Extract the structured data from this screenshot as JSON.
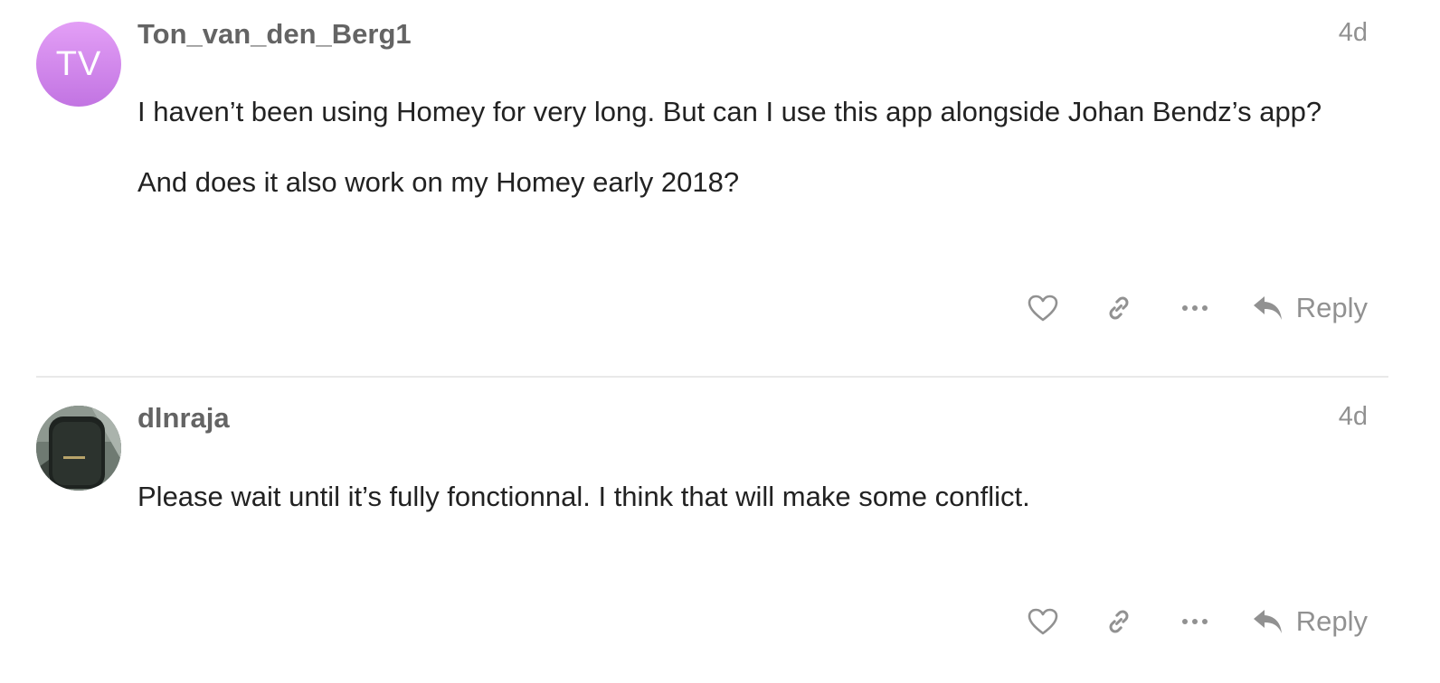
{
  "colors": {
    "avatar_tv_gradient_top": "#e39ff6",
    "avatar_tv_gradient_bottom": "#c274e2",
    "username": "#646464",
    "date": "#919191",
    "body_text": "#222222",
    "icon": "#919191",
    "divider": "#e9e9e9"
  },
  "posts": [
    {
      "username": "Ton_van_den_Berg1",
      "avatar_initials": "TV",
      "avatar_type": "letters",
      "date": "4d",
      "paragraphs": [
        "I haven’t been using Homey for very long. But can I use this app alongside Johan Bendz’s app?",
        "And does it also work on my Homey early 2018?"
      ],
      "actions": {
        "like_icon": "heart-icon",
        "link_icon": "link-icon",
        "more_icon": "ellipsis-icon",
        "reply_label": "Reply"
      }
    },
    {
      "username": "dlnraja",
      "avatar_type": "photo",
      "date": "4d",
      "paragraphs": [
        "Please wait until it’s fully fonctionnal. I think that will make some conflict."
      ],
      "actions": {
        "like_icon": "heart-icon",
        "link_icon": "link-icon",
        "more_icon": "ellipsis-icon",
        "reply_label": "Reply"
      }
    }
  ]
}
